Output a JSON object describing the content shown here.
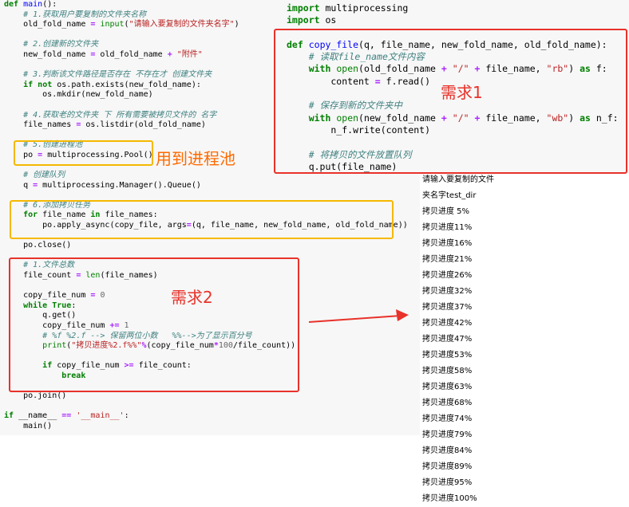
{
  "left_code": [
    "def main():",
    "    # 1.获取用户要复制的文件夹名称",
    "    old_fold_name = input(\"请输入要复制的文件夹名字\")",
    "",
    "    # 2.创建新的文件夹",
    "    new_fold_name = old_fold_name + \"附件\"",
    "",
    "    # 3.判断该文件路径是否存在 不存在才 创建文件夹",
    "    if not os.path.exists(new_fold_name):",
    "        os.mkdir(new_fold_name)",
    "",
    "    # 4.获取老的文件夹 下 所有需要被拷贝文件的 名字",
    "    file_names = os.listdir(old_fold_name)",
    "",
    "    # 5.创建进程池",
    "    po = multiprocessing.Pool()",
    "",
    "    # 创建队列",
    "    q = multiprocessing.Manager().Queue()",
    "",
    "    # 6.添加拷贝任务",
    "    for file_name in file_names:",
    "        po.apply_async(copy_file, args=(q, file_name, new_fold_name, old_fold_name))",
    "",
    "    po.close()",
    "",
    "    # 1.文件总数",
    "    file_count = len(file_names)",
    "",
    "    copy_file_num = 0",
    "    while True:",
    "        q.get()",
    "        copy_file_num += 1",
    "        # %f %2.f --> 保留两位小数   %%-->为了显示百分号",
    "        print(\"拷贝进度%2.f%%\"%(copy_file_num*100/file_count))",
    "",
    "        if copy_file_num >= file_count:",
    "            break",
    "",
    "    po.join()",
    "",
    "if __name__ == '__main__':",
    "    main()"
  ],
  "right_code": [
    "import multiprocessing",
    "import os",
    "",
    "def copy_file(q, file_name, new_fold_name, old_fold_name):",
    "    # 读取file_name文件内容",
    "    with open(old_fold_name + \"/\" + file_name, \"rb\") as f:",
    "        content = f.read()",
    "",
    "    # 保存到新的文件夹中",
    "    with open(new_fold_name + \"/\" + file_name, \"wb\") as n_f:",
    "        n_f.write(content)",
    "",
    "    # 将拷贝的文件放置队列",
    "    q.put(file_name)"
  ],
  "annotations": {
    "pool_note": "用到进程池",
    "req1": "需求1",
    "req2": "需求2"
  },
  "output_lines": [
    "请输入要复制的文件",
    "夹名字test_dir",
    "拷贝进度 5%",
    "拷贝进度11%",
    "拷贝进度16%",
    "拷贝进度21%",
    "拷贝进度26%",
    "拷贝进度32%",
    "拷贝进度37%",
    "拷贝进度42%",
    "拷贝进度47%",
    "拷贝进度53%",
    "拷贝进度58%",
    "拷贝进度63%",
    "拷贝进度68%",
    "拷贝进度74%",
    "拷贝进度79%",
    "拷贝进度84%",
    "拷贝进度89%",
    "拷贝进度95%",
    "拷贝进度100%"
  ],
  "colors": {
    "yellow_box": "#f5b800",
    "red_box": "#e8322a",
    "note_orange": "#ff6a00",
    "note_red": "#e8322a"
  }
}
